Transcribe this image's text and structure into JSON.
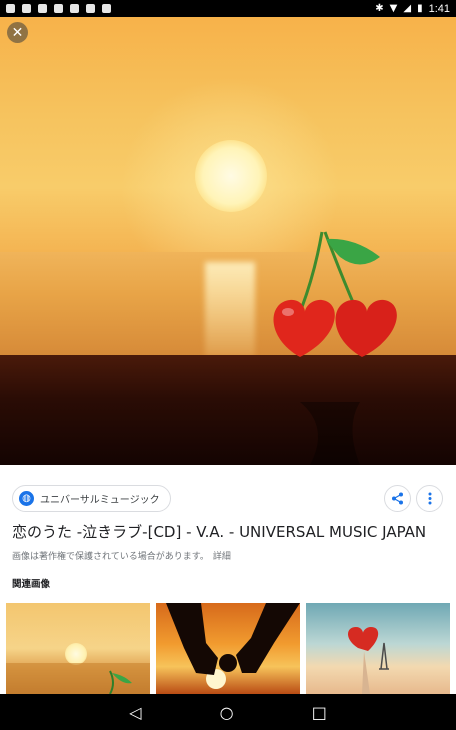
{
  "status_bar": {
    "time": "1:41"
  },
  "viewer": {
    "close_label": "✕"
  },
  "source": {
    "name": "ユニバーサルミュージック"
  },
  "actions": {
    "share_icon": "share-icon",
    "more_icon": "more-vert-icon"
  },
  "image_title": "恋のうた -泣きラブ-[CD] - V.A. - UNIVERSAL MUSIC JAPAN",
  "copyright_notice": "画像は著作権で保護されている場合があります。",
  "detail_link": "詳細",
  "related_heading": "関連画像",
  "nav": {
    "back": "◁",
    "home": "○",
    "recents": "□"
  },
  "colors": {
    "accent": "#1a73e8",
    "cherry": "#e0261c",
    "leaf": "#3aa545"
  }
}
